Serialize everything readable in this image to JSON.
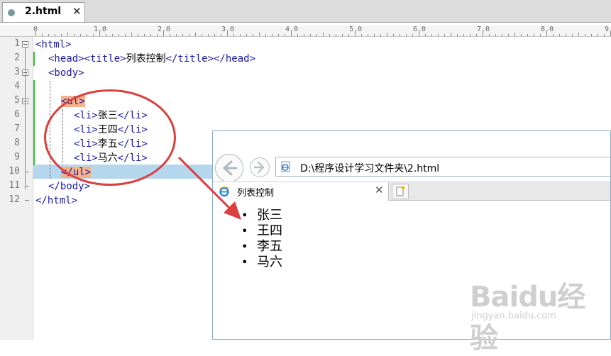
{
  "editor": {
    "tab_label": "2.html",
    "tab_close": "✕",
    "ruler_marks": [
      "0",
      "1.0",
      "2.0",
      "3.0",
      "4.0",
      "5.0",
      "6.0",
      "7.0",
      "8.0",
      "9.0"
    ],
    "active_line": 10,
    "lines": [
      {
        "num": "1",
        "segments": [
          {
            "t": "tag",
            "v": "<html>"
          }
        ]
      },
      {
        "num": "2",
        "segments": [
          {
            "t": "tag",
            "v": "<head><title>"
          },
          {
            "t": "txt",
            "v": "列表控制"
          },
          {
            "t": "tag",
            "v": "</title></head>"
          }
        ]
      },
      {
        "num": "3",
        "segments": [
          {
            "t": "tag",
            "v": "<body>"
          }
        ]
      },
      {
        "num": "4",
        "segments": []
      },
      {
        "num": "5",
        "segments": [
          {
            "t": "tag",
            "v": "<ul>"
          }
        ]
      },
      {
        "num": "6",
        "segments": [
          {
            "t": "tag",
            "v": "<li>"
          },
          {
            "t": "txt",
            "v": "张三"
          },
          {
            "t": "tag",
            "v": "</li>"
          }
        ]
      },
      {
        "num": "7",
        "segments": [
          {
            "t": "tag",
            "v": "<li>"
          },
          {
            "t": "txt",
            "v": "王四"
          },
          {
            "t": "tag",
            "v": "</li>"
          }
        ]
      },
      {
        "num": "8",
        "segments": [
          {
            "t": "tag",
            "v": "<li>"
          },
          {
            "t": "txt",
            "v": "李五"
          },
          {
            "t": "tag",
            "v": "</li>"
          }
        ]
      },
      {
        "num": "9",
        "segments": [
          {
            "t": "tag",
            "v": "<li>"
          },
          {
            "t": "txt",
            "v": "马六"
          },
          {
            "t": "tag",
            "v": "</li>"
          }
        ]
      },
      {
        "num": "10",
        "segments": [
          {
            "t": "tag",
            "v": "</ul>"
          }
        ]
      },
      {
        "num": "11",
        "segments": [
          {
            "t": "tag",
            "v": "</body>"
          }
        ]
      },
      {
        "num": "12",
        "segments": [
          {
            "t": "tag",
            "v": "</html>"
          }
        ]
      }
    ]
  },
  "browser": {
    "address": "D:\\程序设计学习文件夹\\2.html",
    "tab_title": "列表控制",
    "tab_close": "✕",
    "page_items": [
      "张三",
      "王四",
      "李五",
      "马六"
    ]
  },
  "watermark": {
    "main": "Baidu经验",
    "sub": "jingyan.baidu.com"
  },
  "colors": {
    "annotation_red": "#d9403f",
    "tag_blue": "#1a1aa6",
    "current_line": "#b5d7ee",
    "bracket_match": "#f5b28a"
  }
}
